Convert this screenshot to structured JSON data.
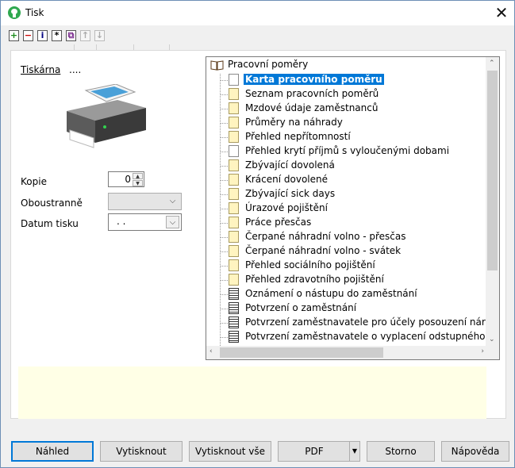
{
  "window": {
    "title": "Tisk",
    "close_glyph": "✕"
  },
  "toolbar": [
    {
      "name": "add-icon",
      "glyph": "+",
      "color": "#1a8a1a",
      "enabled": true
    },
    {
      "name": "remove-icon",
      "glyph": "−",
      "color": "#cc0000",
      "enabled": true
    },
    {
      "name": "info-icon",
      "glyph": "i",
      "color": "#000080",
      "enabled": true
    },
    {
      "name": "properties-icon",
      "glyph": "*",
      "color": "#000000",
      "enabled": true
    },
    {
      "name": "copy-icon",
      "glyph": "⧉",
      "color": "#7b2d8e",
      "enabled": true
    },
    {
      "name": "move-up-icon",
      "glyph": "↑",
      "color": "#aaaaaa",
      "enabled": false
    },
    {
      "name": "move-down-icon",
      "glyph": "↓",
      "color": "#aaaaaa",
      "enabled": false
    }
  ],
  "printer": {
    "label": "Tiskárna",
    "value": "...."
  },
  "form": {
    "kopie_label": "Kopie",
    "kopie_value": "0",
    "oboustranne_label": "Oboustranně",
    "oboustranne_value": "",
    "datum_label": "Datum tisku",
    "datum_value": ". ."
  },
  "tree": {
    "root": "Pracovní poměry",
    "items": [
      {
        "label": "Karta pracovního poměru",
        "icon": "page",
        "selected": true
      },
      {
        "label": "Seznam pracovních poměrů",
        "icon": "folder"
      },
      {
        "label": "Mzdové údaje zaměstnanců",
        "icon": "folder"
      },
      {
        "label": "Průměry na náhrady",
        "icon": "folder"
      },
      {
        "label": "Přehled nepřítomností",
        "icon": "folder"
      },
      {
        "label": "Přehled krytí příjmů s vyloučenými dobami",
        "icon": "page"
      },
      {
        "label": "Zbývající dovolená",
        "icon": "folder"
      },
      {
        "label": "Krácení dovolené",
        "icon": "folder"
      },
      {
        "label": "Zbývající sick days",
        "icon": "folder"
      },
      {
        "label": "Úrazové pojištění",
        "icon": "folder"
      },
      {
        "label": "Práce přesčas",
        "icon": "folder"
      },
      {
        "label": "Čerpané náhradní volno - přesčas",
        "icon": "folder"
      },
      {
        "label": "Čerpané náhradní volno - svátek",
        "icon": "folder"
      },
      {
        "label": "Přehled sociálního pojištění",
        "icon": "folder"
      },
      {
        "label": "Přehled zdravotního pojištění",
        "icon": "folder"
      },
      {
        "label": "Oznámení o nástupu do zaměstnání",
        "icon": "doc"
      },
      {
        "label": "Potvrzení o zaměstnání",
        "icon": "doc"
      },
      {
        "label": "Potvrzení zaměstnavatele pro účely posouzení nároku na p",
        "icon": "doc"
      },
      {
        "label": "Potvrzení zaměstnavatele o vyplacení odstupného pro úče",
        "icon": "doc"
      }
    ]
  },
  "buttons": {
    "nahled": "Náhled",
    "vytisknout": "Vytisknout",
    "vytisknout_vse": "Vytisknout vše",
    "pdf": "PDF",
    "storno": "Storno",
    "napoveda": "Nápověda"
  }
}
